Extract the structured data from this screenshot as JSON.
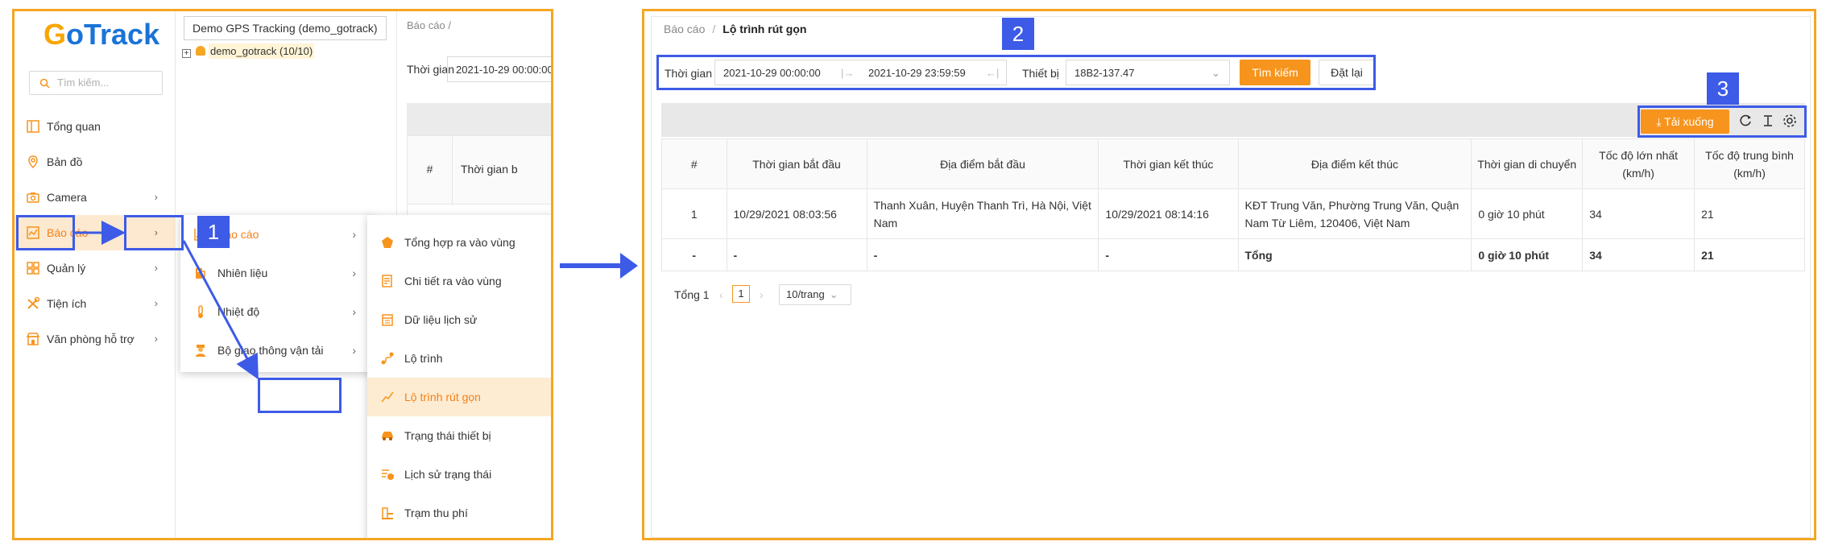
{
  "logo": {
    "part1": "G",
    "part2": "o",
    "part3": "Track"
  },
  "sidebar": {
    "search_placeholder": "Tìm kiếm...",
    "items": [
      {
        "label": "Tổng quan",
        "icon": "dashboard-icon",
        "has_children": false
      },
      {
        "label": "Bản đồ",
        "icon": "map-pin-icon",
        "has_children": false
      },
      {
        "label": "Camera",
        "icon": "camera-icon",
        "has_children": true
      },
      {
        "label": "Báo cáo",
        "icon": "report-chart-icon",
        "has_children": true,
        "active": true
      },
      {
        "label": "Quản lý",
        "icon": "grid-icon",
        "has_children": true
      },
      {
        "label": "Tiện ích",
        "icon": "tools-icon",
        "has_children": true
      },
      {
        "label": "Văn phòng hỗ trợ",
        "icon": "store-icon",
        "has_children": true
      }
    ]
  },
  "tree": {
    "select_value": "Demo GPS Tracking (demo_gotrack)",
    "node_label": "demo_gotrack (10/10)"
  },
  "mini_view": {
    "breadcrumb": "Báo cáo  /",
    "time_label": "Thời gian",
    "time_value": "2021-10-29 00:00:00",
    "col1": "#",
    "col2": "Thời gian b"
  },
  "submenu1": [
    {
      "label": "Báo cáo",
      "icon": "line-chart-icon",
      "active": true
    },
    {
      "label": "Nhiên liệu",
      "icon": "fuel-icon"
    },
    {
      "label": "Nhiệt độ",
      "icon": "thermometer-icon"
    },
    {
      "label": "Bộ giao thông vận tải",
      "icon": "officer-icon"
    }
  ],
  "submenu2": [
    {
      "label": "Tổng hợp ra vào vùng",
      "icon": "pentagon-icon"
    },
    {
      "label": "Chi tiết ra vào vùng",
      "icon": "document-edit-icon"
    },
    {
      "label": "Dữ liệu lịch sử",
      "icon": "calendar-icon"
    },
    {
      "label": "Lộ trình",
      "icon": "route-icon"
    },
    {
      "label": "Lộ trình rút gọn",
      "icon": "trend-line-icon",
      "active": true
    },
    {
      "label": "Trạng thái thiết bị",
      "icon": "car-icon"
    },
    {
      "label": "Lịch sử trạng thái",
      "icon": "list-clock-icon"
    },
    {
      "label": "Trạm thu phí",
      "icon": "toll-station-icon"
    }
  ],
  "badges": {
    "b1": "1",
    "b2": "2",
    "b3": "3"
  },
  "report": {
    "breadcrumb_parent": "Báo cáo",
    "breadcrumb_sep": "/",
    "breadcrumb_current": "Lộ trình rút gọn",
    "filter": {
      "time_label": "Thời gian",
      "start": "2021-10-29 00:00:00",
      "end": "2021-10-29 23:59:59",
      "device_label": "Thiết bị",
      "device_value": "18B2-137.47",
      "search_button": "Tìm kiếm",
      "reset_button": "Đặt lại"
    },
    "download_button": "Tải xuống",
    "columns": [
      "#",
      "Thời gian bắt đầu",
      "Địa điểm bắt đầu",
      "Thời gian kết thúc",
      "Địa điểm kết thúc",
      "Thời gian di chuyển",
      "Tốc độ lớn nhất (km/h)",
      "Tốc độ trung bình (km/h)"
    ],
    "rows": [
      {
        "no": "1",
        "start_time": "10/29/2021 08:03:56",
        "start_place": "Thanh Xuân, Huyện Thanh Trì, Hà Nội, Việt Nam",
        "end_time": "10/29/2021 08:14:16",
        "end_place": "KĐT Trung Văn, Phường Trung Văn, Quận Nam Từ Liêm, 120406, Việt Nam",
        "duration": "0 giờ 10 phút",
        "max_speed": "34",
        "avg_speed": "21"
      }
    ],
    "summary": {
      "no": "-",
      "start_time": "-",
      "start_place": "-",
      "end_time": "-",
      "end_place": "Tổng",
      "duration": "0 giờ 10 phút",
      "max_speed": "34",
      "avg_speed": "21"
    },
    "pagination": {
      "total": "Tổng 1",
      "page": "1",
      "page_size": "10/trang"
    }
  },
  "colors": {
    "accent": "#f7941d",
    "highlight": "#3d5be6",
    "frame": "#f5a623",
    "active_bg": "#fde9cf"
  }
}
